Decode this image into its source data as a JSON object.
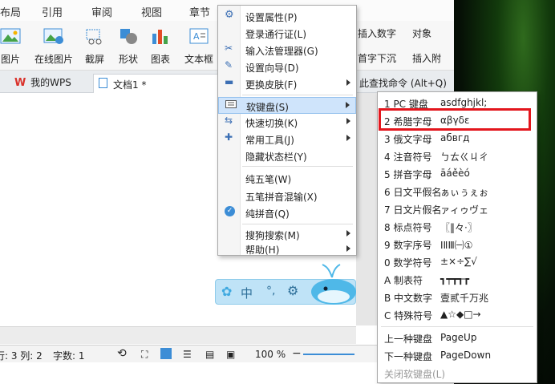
{
  "menu_tabs": [
    "布局",
    "引用",
    "审阅",
    "视图",
    "章节"
  ],
  "ribbon": {
    "buttons": [
      "图片",
      "在线图片",
      "截屏",
      "形状",
      "图表",
      "文本框"
    ],
    "right_items": [
      "插入数字",
      "对象",
      "首字下沉",
      "插入附"
    ]
  },
  "doc_tabs": {
    "wps_label": "我的WPS",
    "doc_label": "文档1 *",
    "search_hint": "此查找命令 (Alt+Q)"
  },
  "statusbar": {
    "position": "行: 3  列: 2",
    "word_count": "字数: 1",
    "zoom": "100 %"
  },
  "context_menu": {
    "items": [
      {
        "label": "设置属性(P)",
        "icon": "gear-icon",
        "submenu": false
      },
      {
        "label": "登录通行证(L)",
        "icon": "",
        "submenu": false
      },
      {
        "label": "输入法管理器(G)",
        "icon": "tools-icon",
        "submenu": false
      },
      {
        "label": "设置向导(D)",
        "icon": "wand-icon",
        "submenu": false
      },
      {
        "label": "更换皮肤(F)",
        "icon": "brush-icon",
        "submenu": true
      },
      {
        "label": "软键盘(S)",
        "icon": "keyboard-icon",
        "submenu": true
      },
      {
        "label": "快速切换(K)",
        "icon": "switch-icon",
        "submenu": true
      },
      {
        "label": "常用工具(J)",
        "icon": "toolbox-icon",
        "submenu": true
      },
      {
        "label": "隐藏状态栏(Y)",
        "icon": "",
        "submenu": false
      },
      {
        "label": "纯五笔(W)",
        "icon": "",
        "submenu": false
      },
      {
        "label": "五笔拼音混输(X)",
        "icon": "",
        "submenu": false
      },
      {
        "label": "纯拼音(Q)",
        "icon": "check-icon",
        "submenu": false
      },
      {
        "label": "搜狗搜索(M)",
        "icon": "",
        "submenu": true
      },
      {
        "label": "帮助(H)",
        "icon": "",
        "submenu": true
      }
    ]
  },
  "soft_keyboard_menu": {
    "items": [
      {
        "label": "1 PC 键盘",
        "chars": "asdfghjkl;"
      },
      {
        "label": "2 希腊字母",
        "chars": "αβγδε"
      },
      {
        "label": "3 俄文字母",
        "chars": "абвгд"
      },
      {
        "label": "4 注音符号",
        "chars": "ㄅㄊㄍㄐㄔ"
      },
      {
        "label": "5 拼音字母",
        "chars": "āáěèó"
      },
      {
        "label": "6 日文平假名",
        "chars": "ぁぃぅぇぉ"
      },
      {
        "label": "7 日文片假名",
        "chars": "ァィゥヴェ"
      },
      {
        "label": "8 标点符号",
        "chars": "〖‖々·〗"
      },
      {
        "label": "9 数字序号",
        "chars": "ⅠⅡⅢ㈠①"
      },
      {
        "label": "0 数学符号",
        "chars": "±×÷∑√"
      },
      {
        "label": "A 制表符",
        "chars": "┓┯┳┱┲"
      },
      {
        "label": "B 中文数字",
        "chars": "壹贰千万兆"
      },
      {
        "label": "C 特殊符号",
        "chars": "▲☆◆□→"
      },
      {
        "label": "上一种键盘",
        "chars": "PageUp"
      },
      {
        "label": "下一种键盘",
        "chars": "PageDown"
      },
      {
        "label": "关闭软键盘(L)",
        "chars": ""
      }
    ]
  },
  "colors": {
    "highlight_border": "#e3161d",
    "menu_highlight": "#cfe4fb",
    "wps_red": "#d9312a",
    "toolbar_blue": "#3fa9e0"
  }
}
